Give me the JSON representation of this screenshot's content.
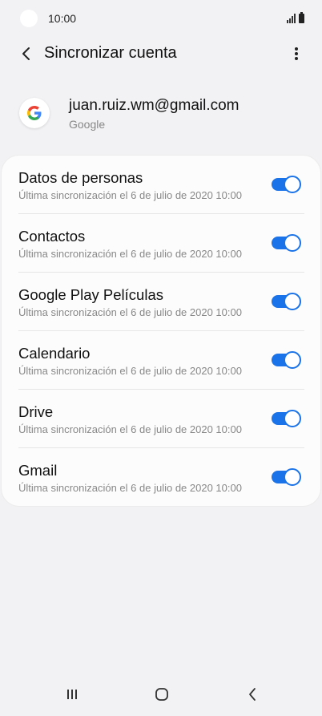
{
  "status": {
    "time": "10:00"
  },
  "app_bar": {
    "title": "Sincronizar cuenta"
  },
  "account": {
    "email": "juan.ruiz.wm@gmail.com",
    "type": "Google"
  },
  "sync_items": [
    {
      "title": "Datos de personas",
      "subtitle": "Última sincronización el 6 de julio de 2020 10:00",
      "enabled": true
    },
    {
      "title": "Contactos",
      "subtitle": "Última sincronización el 6 de julio de 2020 10:00",
      "enabled": true
    },
    {
      "title": "Google Play Películas",
      "subtitle": "Última sincronización el 6 de julio de 2020 10:00",
      "enabled": true
    },
    {
      "title": "Calendario",
      "subtitle": "Última sincronización el 6 de julio de 2020 10:00",
      "enabled": true
    },
    {
      "title": "Drive",
      "subtitle": "Última sincronización el 6 de julio de 2020 10:00",
      "enabled": true
    },
    {
      "title": "Gmail",
      "subtitle": "Última sincronización el 6 de julio de 2020 10:00",
      "enabled": true
    }
  ],
  "colors": {
    "accent": "#1a73e8",
    "background": "#f2f2f4"
  },
  "icons": [
    "back-arrow-icon",
    "more-vert-icon",
    "google-icon",
    "recents-icon",
    "home-icon",
    "nav-back-icon"
  ]
}
